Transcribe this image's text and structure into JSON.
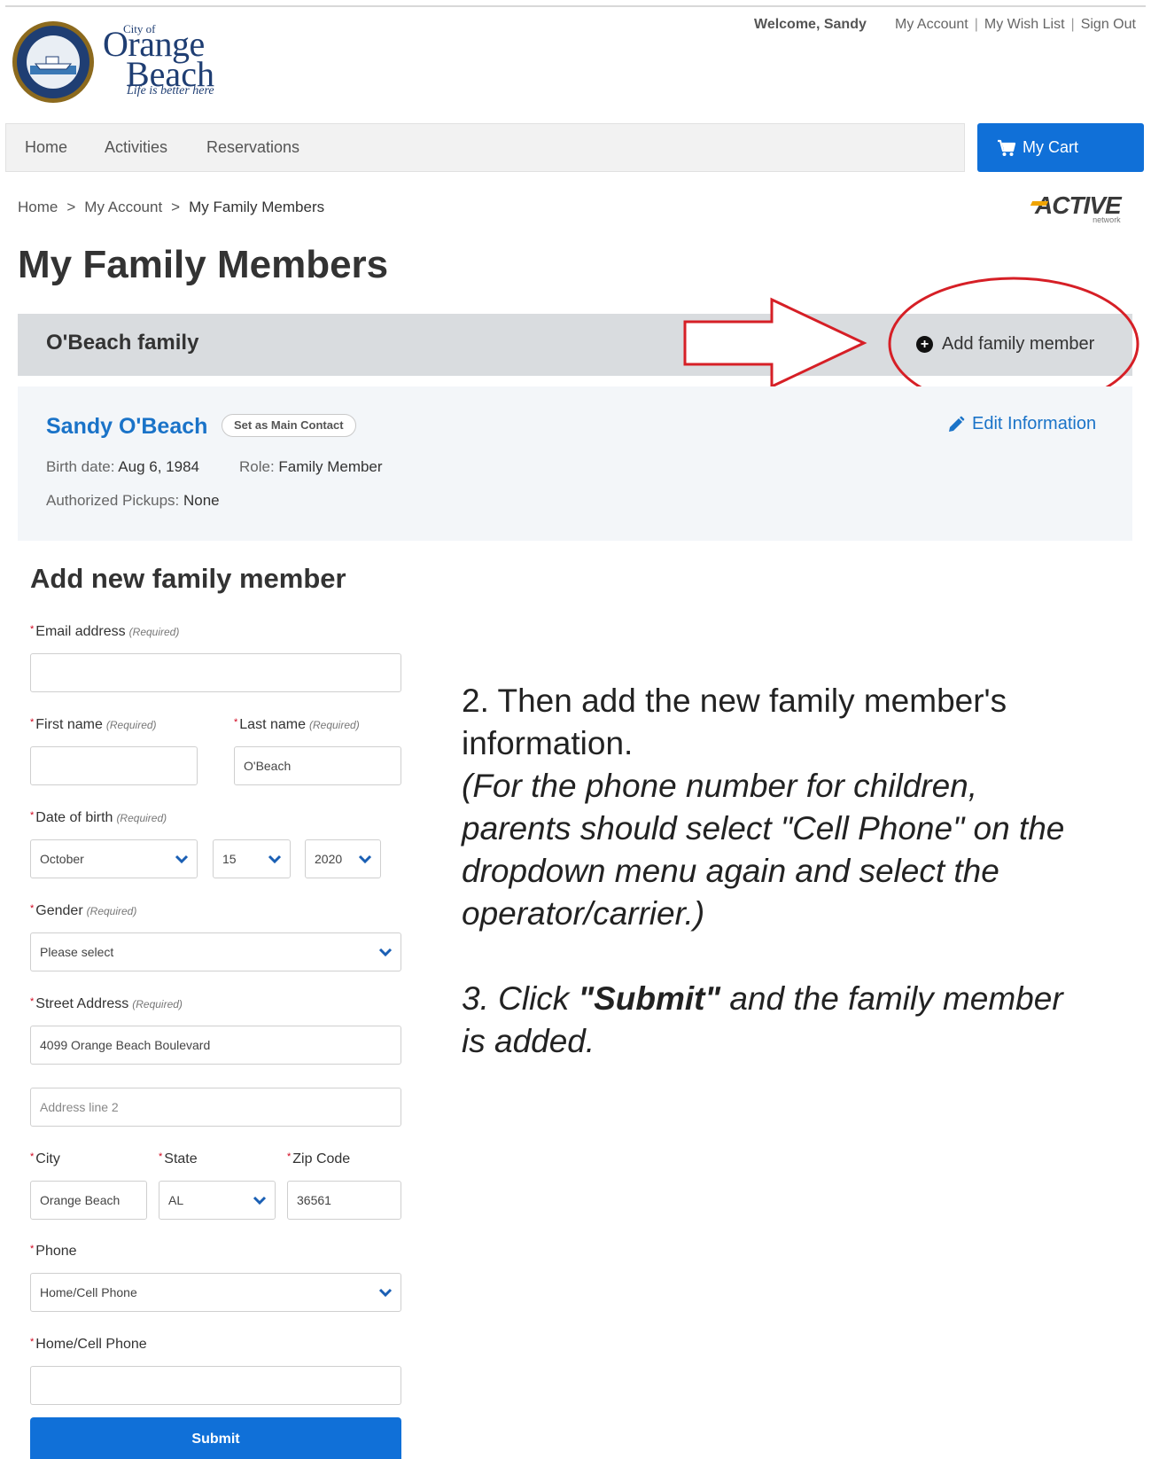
{
  "header": {
    "logo_city_of": "City of",
    "logo_orange": "Orange",
    "logo_beach": "Beach",
    "logo_tagline": "Life is better here",
    "welcome": "Welcome, Sandy",
    "links": [
      "My Account",
      "My Wish List",
      "Sign Out"
    ],
    "separator": "|"
  },
  "nav": {
    "items": [
      "Home",
      "Activities",
      "Reservations"
    ],
    "cart_label": "My Cart",
    "cart_icon": "shopping-cart-icon"
  },
  "breadcrumb": [
    "Home",
    "My Account",
    "My Family Members"
  ],
  "breadcrumb_sep": ">",
  "active_logo": {
    "text": "ACTIVE",
    "sub": "network"
  },
  "page_title": "My Family Members",
  "family": {
    "name": "O'Beach family",
    "add_label": "Add family member"
  },
  "member": {
    "name": "Sandy O'Beach",
    "main_contact_label": "Set as Main Contact",
    "edit_label": "Edit Information",
    "birth_label": "Birth date:",
    "birth_value": "Aug 6, 1984",
    "role_label": "Role:",
    "role_value": "Family Member",
    "pickups_label": "Authorized Pickups:",
    "pickups_value": "None"
  },
  "form": {
    "title": "Add new family member",
    "required_tag": "(Required)",
    "email_label": "Email address",
    "email_value": "",
    "first_name_label": "First name",
    "first_name_value": "",
    "last_name_label": "Last name",
    "last_name_value": "O'Beach",
    "dob_label": "Date of birth",
    "dob_month": "October",
    "dob_day": "15",
    "dob_year": "2020",
    "gender_label": "Gender",
    "gender_value": "Please select",
    "street_label": "Street Address",
    "street_value": "4099 Orange Beach Boulevard",
    "address2_placeholder": "Address line 2",
    "city_label": "City",
    "city_value": "Orange Beach",
    "state_label": "State",
    "state_value": "AL",
    "zip_label": "Zip Code",
    "zip_value": "36561",
    "phone_label": "Phone",
    "phone_type_value": "Home/Cell Phone",
    "phone_number_label": "Home/Cell Phone",
    "phone_number_value": "",
    "submit_label": "Submit"
  },
  "instructions": {
    "step2_line1": "2. Then add the new family member's",
    "step2_line2": "information.",
    "note_line1": "(For the phone number for children,",
    "note_line2": "parents should select \"Cell Phone\" on the",
    "note_line3": "dropdown menu again and select the",
    "note_line4": "operator/carrier.)",
    "step3_prefix": "3. Click ",
    "step3_bold": "\"Submit\"",
    "step3_suffix": " and the family member",
    "step3_line2": "is added."
  },
  "colors": {
    "brand_blue": "#1070d8",
    "link_blue": "#1a73c8",
    "annotation_red": "#d61f26",
    "family_bar": "#d9dcdf"
  }
}
